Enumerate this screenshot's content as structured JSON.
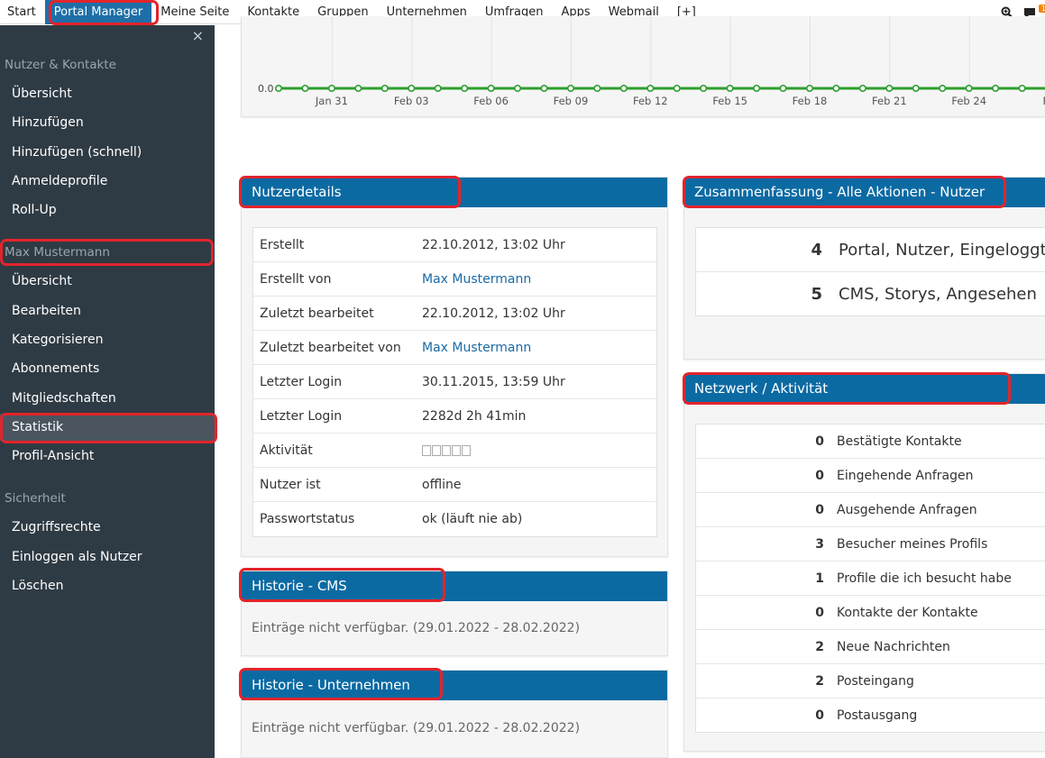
{
  "topnav": {
    "items": [
      "Start",
      "Portal Manager",
      "Meine Seite",
      "Kontakte",
      "Gruppen",
      "Unternehmen",
      "Umfragen",
      "Apps",
      "Webmail",
      "[+]"
    ],
    "notification_count": "1"
  },
  "sidebar": {
    "close_label": "×",
    "section1_title": "Nutzer & Kontakte",
    "section1_items": [
      "Übersicht",
      "Hinzufügen",
      "Hinzufügen (schnell)",
      "Anmeldeprofile",
      "Roll-Up"
    ],
    "section2_title": "Max Mustermann",
    "section2_items": [
      "Übersicht",
      "Bearbeiten",
      "Kategorisieren",
      "Abonnements",
      "Mitgliedschaften",
      "Statistik",
      "Profil-Ansicht"
    ],
    "section3_title": "Sicherheit",
    "section3_items": [
      "Zugriffsrechte",
      "Einloggen als Nutzer",
      "Löschen"
    ]
  },
  "chart": {
    "y_label": "0.0",
    "x_ticks": [
      "Jan 31",
      "Feb 03",
      "Feb 06",
      "Feb 09",
      "Feb 12",
      "Feb 15",
      "Feb 18",
      "Feb 21",
      "Feb 24",
      "Fe"
    ]
  },
  "chart_data": {
    "type": "line",
    "x_tick_labels": [
      "Jan 31",
      "Feb 03",
      "Feb 06",
      "Feb 09",
      "Feb 12",
      "Feb 15",
      "Feb 18",
      "Feb 21",
      "Feb 24",
      "Fe"
    ],
    "x_start": "Jan 29",
    "x_end": "Feb 28",
    "series": [
      {
        "values": [
          0,
          0,
          0,
          0,
          0,
          0,
          0,
          0,
          0,
          0,
          0,
          0,
          0,
          0,
          0,
          0,
          0,
          0,
          0,
          0,
          0,
          0,
          0,
          0,
          0,
          0,
          0,
          0,
          0,
          0,
          0
        ]
      }
    ],
    "y_tick_labels": [
      "0.0"
    ],
    "color": "#2e9e2e"
  },
  "nutzerdetails": {
    "title": "Nutzerdetails",
    "rows": [
      {
        "key": "Erstellt",
        "value": "22.10.2012, 13:02 Uhr"
      },
      {
        "key": "Erstellt von",
        "value": "Max Mustermann"
      },
      {
        "key": "Zuletzt bearbeitet",
        "value": "22.10.2012, 13:02 Uhr"
      },
      {
        "key": "Zuletzt bearbeitet von",
        "value": "Max Mustermann"
      },
      {
        "key": "Letzter Login",
        "value": "30.11.2015, 13:59 Uhr"
      },
      {
        "key": "Letzter Login",
        "value": "2282d 2h 41min"
      },
      {
        "key": "Aktivität",
        "value": ""
      },
      {
        "key": "Nutzer ist",
        "value": "offline"
      },
      {
        "key": "Passwortstatus",
        "value": "ok (läuft nie ab)"
      }
    ]
  },
  "historie_cms": {
    "title": "Historie - CMS",
    "note": "Einträge nicht verfügbar. (29.01.2022 - 28.02.2022)"
  },
  "historie_unternehmen": {
    "title": "Historie - Unternehmen",
    "note": "Einträge nicht verfügbar. (29.01.2022 - 28.02.2022)"
  },
  "zusammenfassung": {
    "title": "Zusammenfassung - Alle Aktionen - Nutzer",
    "rows": [
      {
        "count": "4",
        "label": "Portal, Nutzer, Eingeloggt"
      },
      {
        "count": "5",
        "label": "CMS, Storys, Angesehen"
      }
    ]
  },
  "netzwerk": {
    "title": "Netzwerk / Aktivität",
    "rows": [
      {
        "count": "0",
        "label": "Bestätigte Kontakte"
      },
      {
        "count": "0",
        "label": "Eingehende Anfragen"
      },
      {
        "count": "0",
        "label": "Ausgehende Anfragen"
      },
      {
        "count": "3",
        "label": "Besucher meines Profils"
      },
      {
        "count": "1",
        "label": "Profile die ich besucht habe"
      },
      {
        "count": "0",
        "label": "Kontakte der Kontakte"
      },
      {
        "count": "2",
        "label": "Neue Nachrichten"
      },
      {
        "count": "2",
        "label": "Posteingang"
      },
      {
        "count": "0",
        "label": "Postausgang"
      }
    ]
  }
}
